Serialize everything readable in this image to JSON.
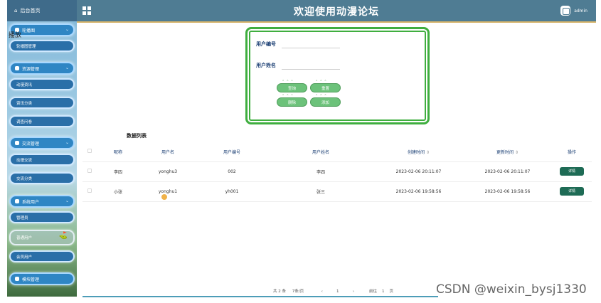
{
  "header": {
    "title": "欢迎使用动漫论坛",
    "username": "admin"
  },
  "sidebar": {
    "brand": "后台首页",
    "overlay_char": "播放",
    "groups": [
      {
        "label": "轮播图",
        "items": [
          "轮播图管理"
        ]
      },
      {
        "label": "资源管理",
        "items": [
          "动漫资讯",
          "资讯分类",
          "调查问卷"
        ]
      },
      {
        "label": "交流管理",
        "items": [
          "动漫交流",
          "交流分类"
        ]
      },
      {
        "label": "系统用户",
        "items": [
          "管理员",
          "普通用户",
          "会员用户"
        ]
      },
      {
        "label": "模块管理",
        "items": []
      }
    ]
  },
  "search": {
    "user_no_label": "用户编号",
    "user_name_label": "用户姓名",
    "user_no_value": "",
    "user_name_value": "",
    "buttons": [
      "查询",
      "重置",
      "删除",
      "添加"
    ]
  },
  "table": {
    "title": "数据列表",
    "columns": [
      "昵称",
      "用户名",
      "用户编号",
      "用户姓名",
      "创建时间",
      "更新时间",
      "操作"
    ],
    "sort_mark": "⇕",
    "rows": [
      {
        "nickname": "李四",
        "username": "yonghu3",
        "user_no": "002",
        "name": "李四",
        "created": "2023-02-06 20:11:07",
        "updated": "2023-02-06 20:11:07",
        "action": "详情"
      },
      {
        "nickname": "小张",
        "username": "yonghu1",
        "user_no": "yh001",
        "name": "张三",
        "created": "2023-02-06 19:58:56",
        "updated": "2023-02-06 19:58:56",
        "action": "详情"
      }
    ]
  },
  "pager": {
    "total": "共 2 条",
    "per_page": "7条/页",
    "prev": "‹",
    "current_page": "1",
    "next": "›",
    "goto_label": "前往",
    "goto_value": "1",
    "page_unit": "页"
  },
  "watermark": "CSDN @weixin_bysj1330"
}
